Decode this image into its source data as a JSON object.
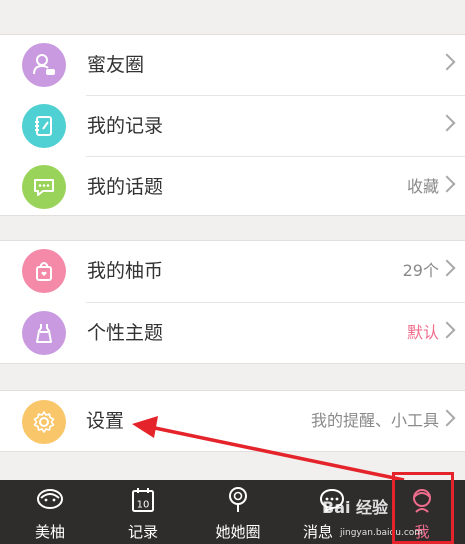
{
  "menu": {
    "group1": [
      {
        "label": "蜜友圈",
        "value": "",
        "color": "#c99adf",
        "icon": "friends-icon"
      },
      {
        "label": "我的记录",
        "value": "",
        "color": "#4fd0d2",
        "icon": "notebook-icon"
      },
      {
        "label": "我的话题",
        "value": "收藏",
        "color": "#9ad35a",
        "icon": "chat-bubble-icon"
      }
    ],
    "group2": [
      {
        "label": "我的柚币",
        "value": "29个",
        "color": "#f48aa8",
        "icon": "shopping-bag-icon"
      },
      {
        "label": "个性主题",
        "value": "默认",
        "color": "#c99adf",
        "icon": "dress-icon"
      }
    ],
    "group3": [
      {
        "label": "设置",
        "value": "我的提醒、小工具",
        "color": "#f9c66a",
        "icon": "gear-icon"
      }
    ]
  },
  "tabs": [
    {
      "label": "美柚",
      "icon": "bowl-icon"
    },
    {
      "label": "记录",
      "icon": "calendar-icon"
    },
    {
      "label": "她她圈",
      "icon": "lollipop-icon"
    },
    {
      "label": "消息",
      "icon": "message-icon"
    },
    {
      "label": "我",
      "icon": "profile-icon"
    }
  ],
  "calendar_day": "10",
  "watermark": {
    "text": "Bai 经验",
    "sub": "jingyan.baidu.com"
  },
  "colors": {
    "accent_pink": "#f06c8c",
    "annotation_red": "#e4242a",
    "tabbar": "#2f2d2c"
  }
}
